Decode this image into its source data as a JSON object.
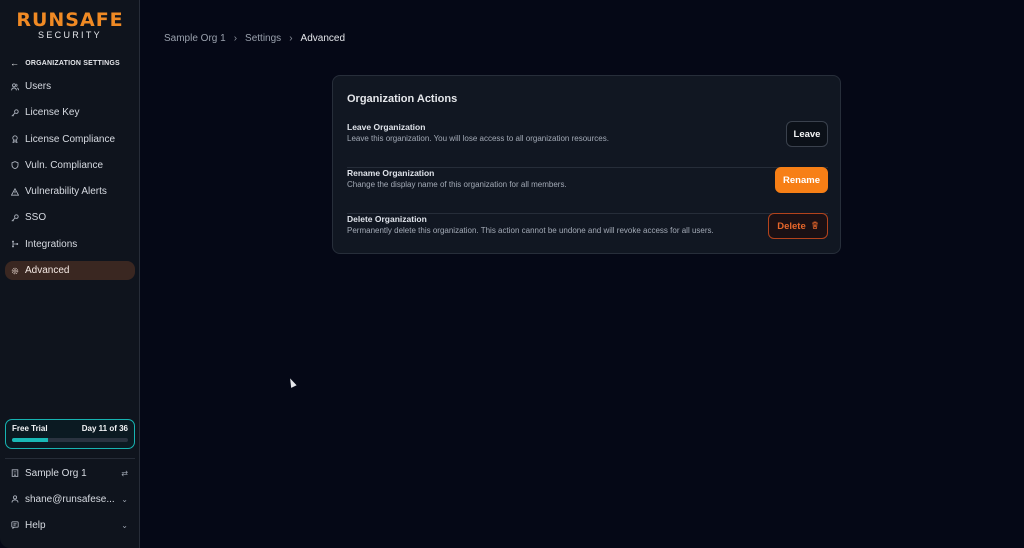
{
  "logo": {
    "main": "RUNSAFE",
    "sub": "SECURITY"
  },
  "sidebar": {
    "section_title": "ORGANIZATION SETTINGS",
    "items": [
      {
        "label": "Users",
        "icon": "users-icon"
      },
      {
        "label": "License Key",
        "icon": "key-icon"
      },
      {
        "label": "License Compliance",
        "icon": "compliance-icon"
      },
      {
        "label": "Vuln. Compliance",
        "icon": "shield-icon"
      },
      {
        "label": "Vulnerability Alerts",
        "icon": "alert-icon"
      },
      {
        "label": "SSO",
        "icon": "key-icon"
      },
      {
        "label": "Integrations",
        "icon": "git-icon"
      },
      {
        "label": "Advanced",
        "icon": "gear-icon",
        "active": true
      }
    ],
    "trial": {
      "label": "Free Trial",
      "day": "Day 11 of 36",
      "progress": 0.31
    },
    "org": {
      "label": "Sample Org 1"
    },
    "user": {
      "label": "shane@runsafese..."
    },
    "help": {
      "label": "Help"
    }
  },
  "breadcrumb": {
    "items": [
      "Sample Org 1",
      "Settings",
      "Advanced"
    ]
  },
  "card": {
    "title": "Organization Actions",
    "rows": [
      {
        "title": "Leave Organization",
        "desc": "Leave this organization. You will lose access to all organization resources.",
        "button": "Leave"
      },
      {
        "title": "Rename Organization",
        "desc": "Change the display name of this organization for all members.",
        "button": "Rename"
      },
      {
        "title": "Delete Organization",
        "desc": "Permanently delete this organization. This action cannot be undone and will revoke access for all users.",
        "button": "Delete"
      }
    ]
  },
  "colors": {
    "accent": "#f77f16",
    "danger": "#e6662a",
    "trial": "#19b9b6",
    "background": "#050816"
  }
}
